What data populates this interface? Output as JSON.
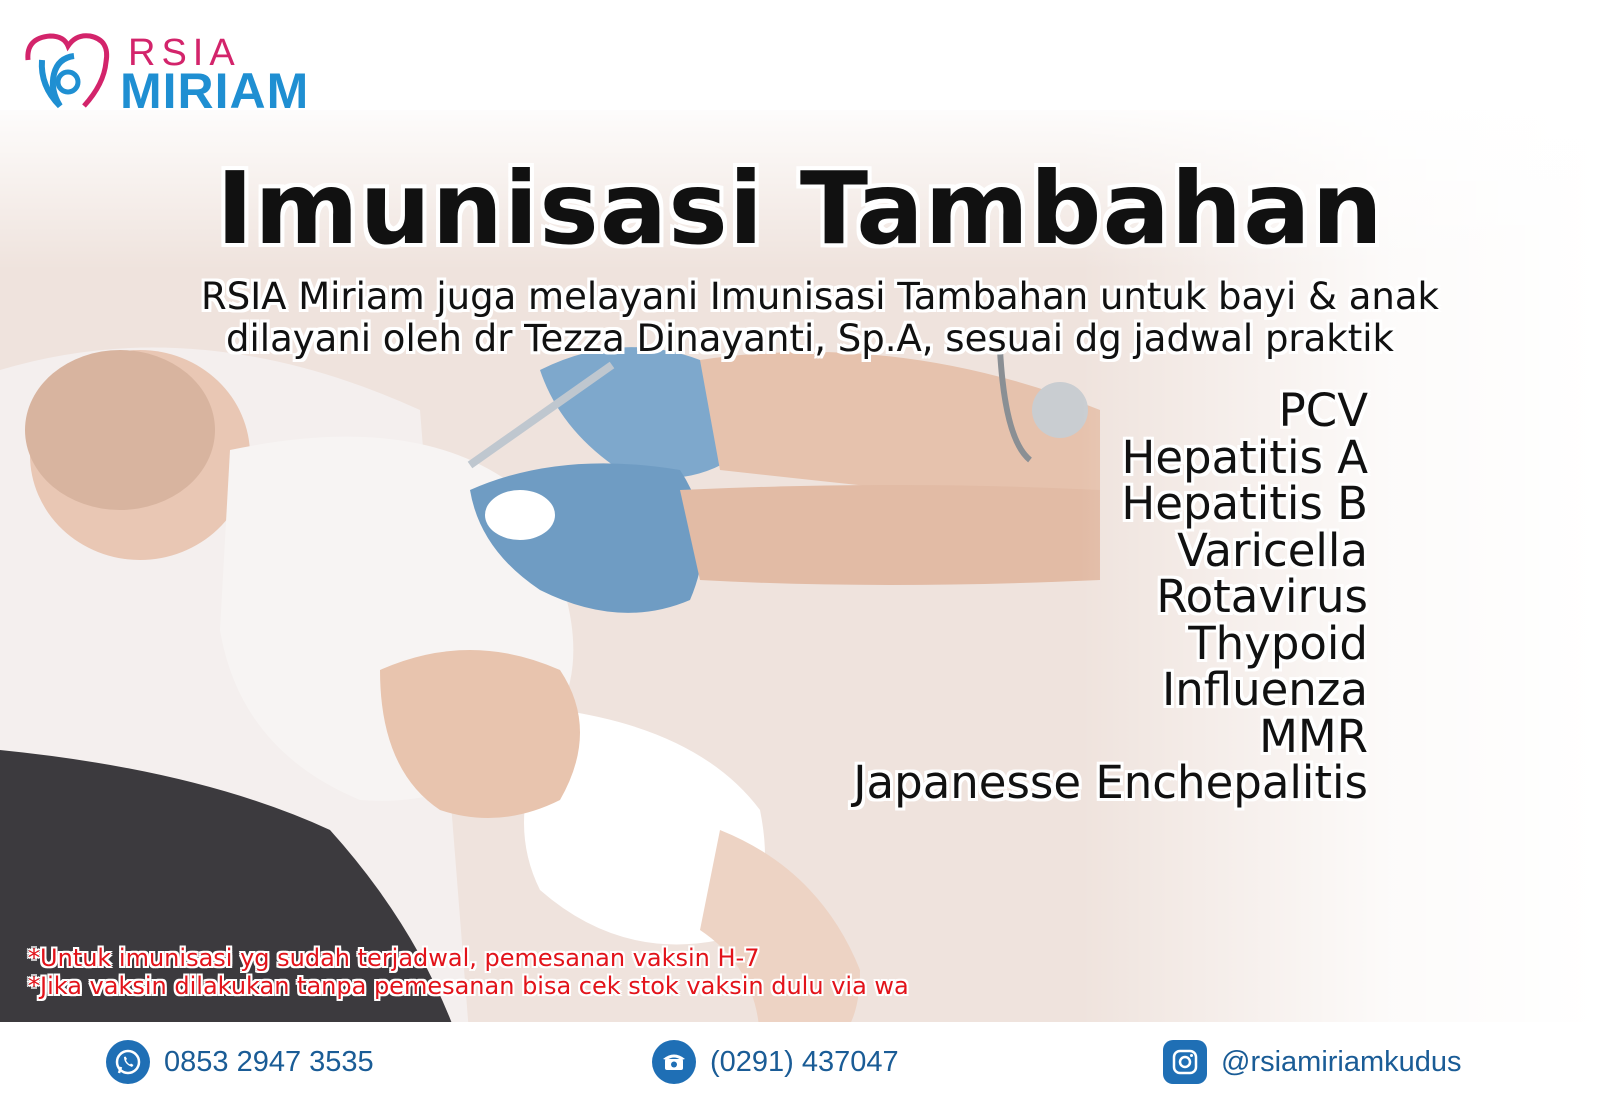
{
  "logo": {
    "top_text": "RSIA",
    "bottom_text": "MIRIAM",
    "colors": {
      "pink": "#d3246b",
      "blue": "#1f8fd2"
    }
  },
  "title": "Imunisasi Tambahan",
  "subtitle": {
    "line1": "RSIA Miriam juga melayani Imunisasi Tambahan untuk bayi & anak",
    "line2": "dilayani oleh dr Tezza Dinayanti, Sp.A, sesuai dg jadwal praktik"
  },
  "vaccines": [
    "PCV",
    "Hepatitis A",
    "Hepatitis B",
    "Varicella",
    "Rotavirus",
    "Thypoid",
    "Influenza",
    "MMR",
    "Japanesse Enchepalitis"
  ],
  "notes": {
    "line1": "*Untuk imunisasi yg sudah terjadwal, pemesanan vaksin H-7",
    "line2": "*Jika vaksin dilakukan tanpa pemesanan bisa cek stok vaksin dulu via wa",
    "color": "#e2131a"
  },
  "contacts": {
    "whatsapp": {
      "icon": "whatsapp-icon",
      "text": "0853 2947 3535"
    },
    "phone": {
      "icon": "telephone-icon",
      "text": "(0291) 437047"
    },
    "instagram": {
      "icon": "instagram-icon",
      "text": "@rsiamiriamkudus"
    }
  }
}
